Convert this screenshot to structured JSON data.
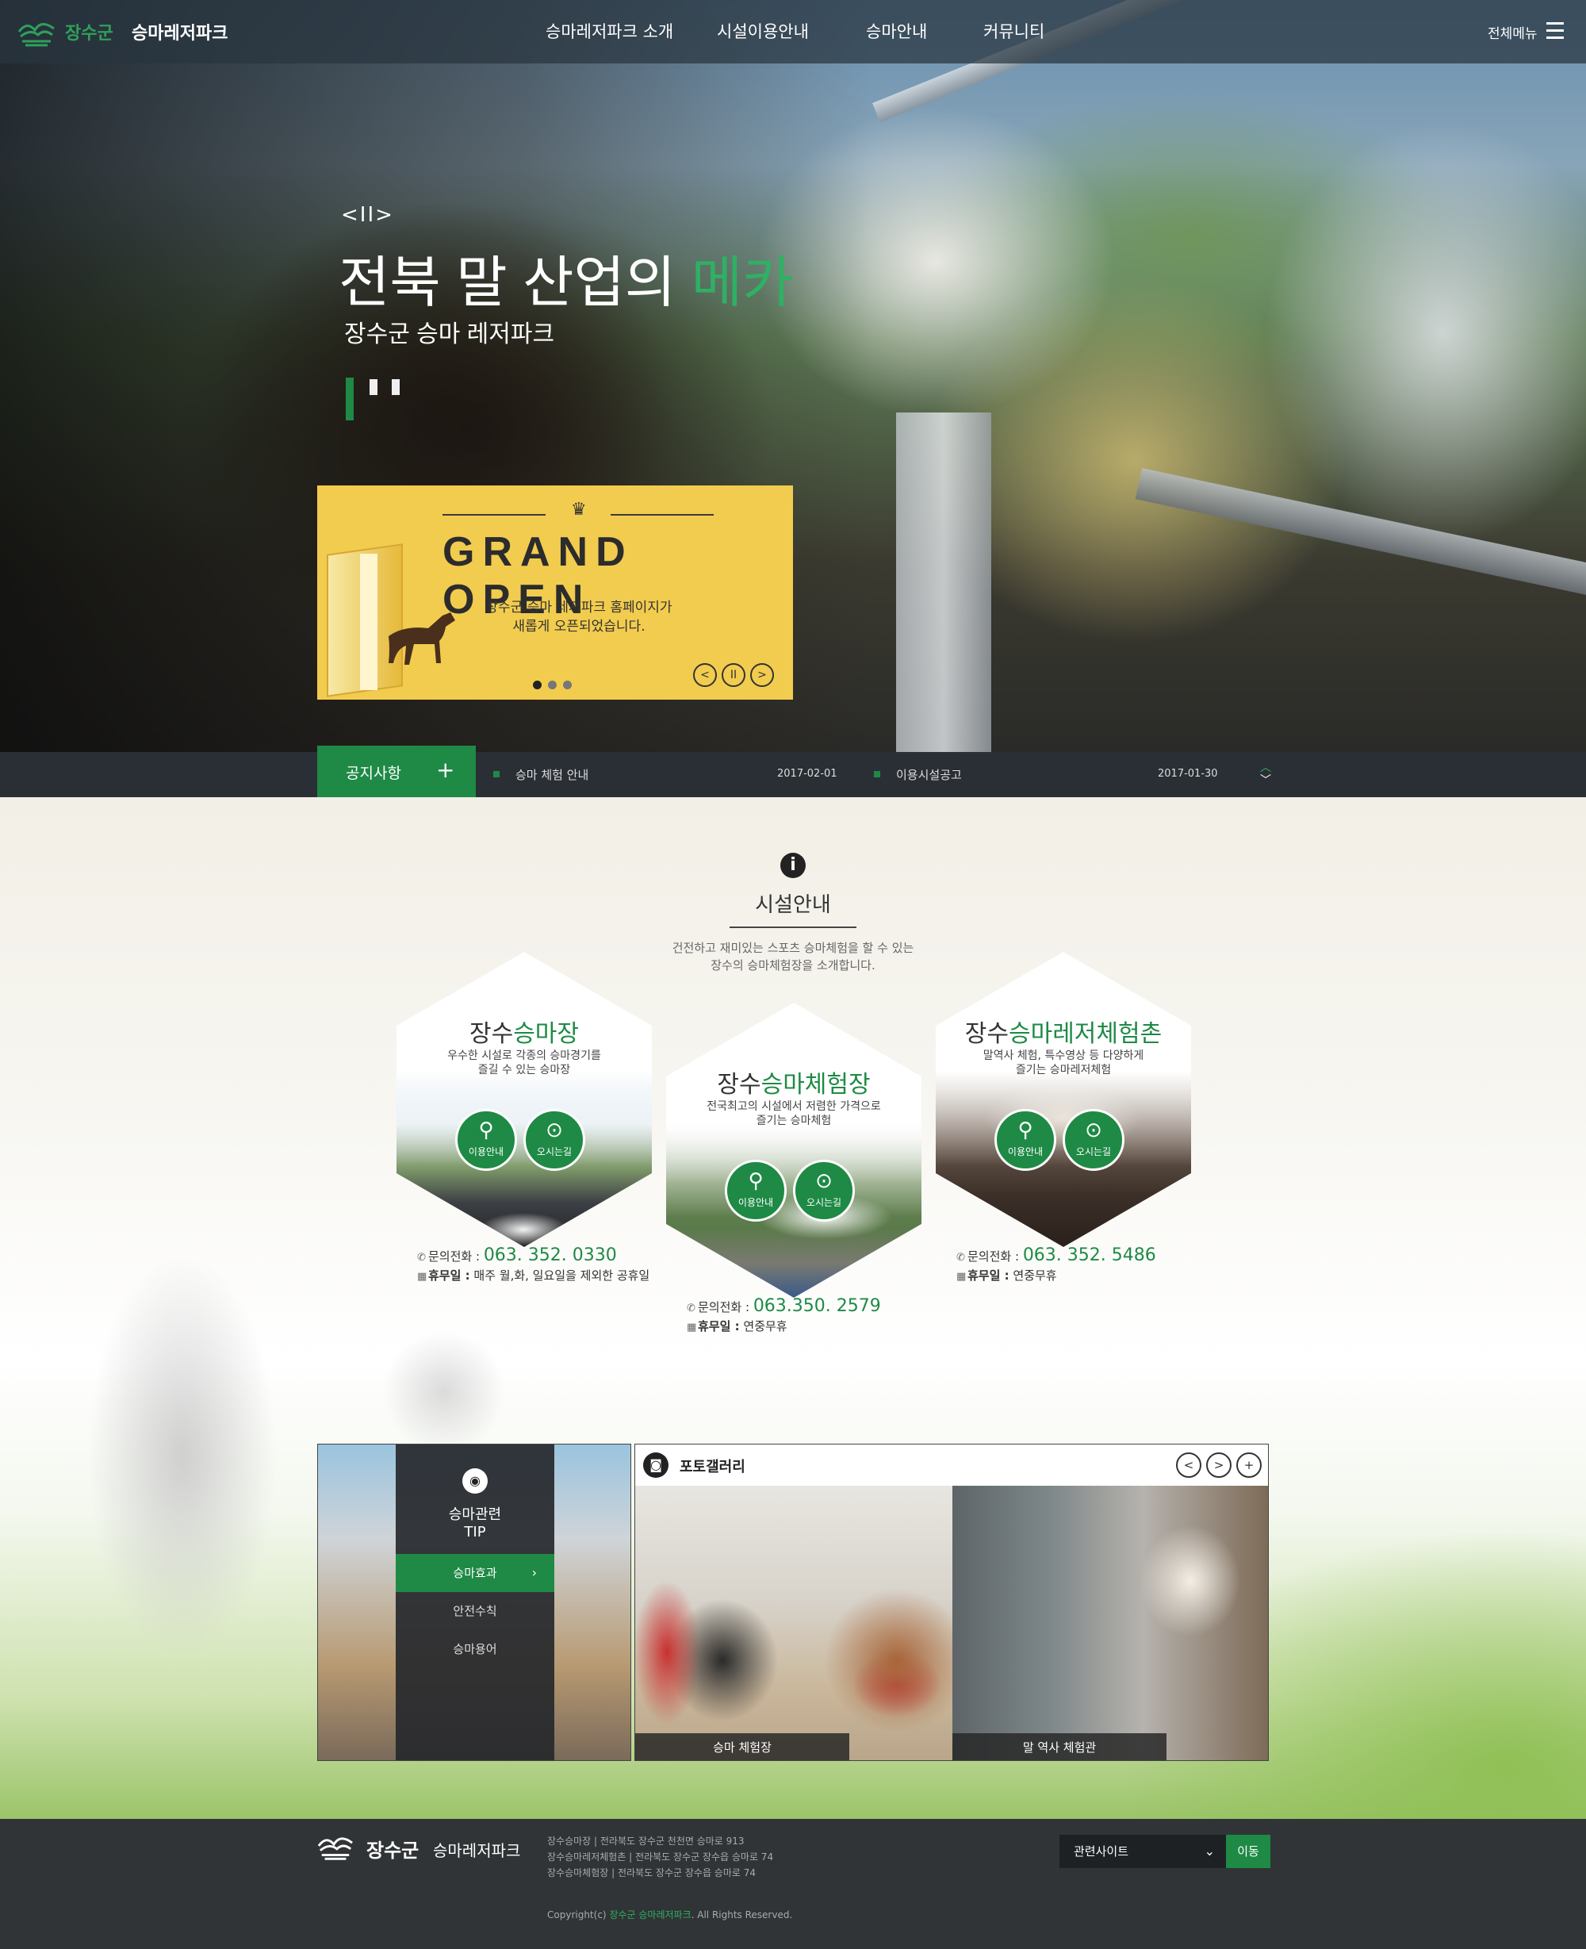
{
  "nav": {
    "brand": "장수군",
    "park": "승마레저파크",
    "items": [
      "승마레저파크 소개",
      "시설이용안내",
      "승마안내",
      "커뮤니티"
    ],
    "all_menu": "전체메뉴"
  },
  "hero": {
    "controls": "<II>",
    "title_main": "전북 말 산업의",
    "title_accent": "메카",
    "subtitle": "장수군 승마 레저파크"
  },
  "popup": {
    "title": "GRAND OPEN",
    "desc_line1": "장수군 승마 레저파크 홈페이지가",
    "desc_line2": "새롭게 오픈되었습니다.",
    "prev": "<",
    "pause": "II",
    "next": ">"
  },
  "notice": {
    "tab": "공지사항",
    "plus": "+",
    "items": [
      {
        "title": "승마 체험 안내",
        "date": "2017-02-01"
      },
      {
        "title": "이용시설공고",
        "date": "2017-01-30"
      }
    ]
  },
  "facilities": {
    "title": "시설안내",
    "desc_line1": "건전하고 재미있는 스포츠 승마체험을 할 수 있는",
    "desc_line2": "장수의 승마체험장을 소개합니다.",
    "btn_info": "이용안내",
    "btn_map": "오시는길",
    "phone_label": "문의전화 :",
    "holiday_label": "휴무일 :",
    "cards": [
      {
        "title_a": "장수",
        "title_b": "승마장",
        "desc1": "우수한 시설로 각종의 승마경기를",
        "desc2": "즐길 수 있는 승마장",
        "phone": "063. 352. 0330",
        "holiday": "매주 월,화, 일요일을 제외한 공휴일"
      },
      {
        "title_a": "장수",
        "title_b": "승마체험장",
        "desc1": "전국최고의 시설에서 저렴한 가격으로",
        "desc2": "즐기는 승마체험",
        "phone": "063.350. 2579",
        "holiday": "연중무휴"
      },
      {
        "title_a": "장수",
        "title_b": "승마레저체험촌",
        "desc1": "말역사 체험, 특수영상 등 다양하게",
        "desc2": "즐기는 승마레저체험",
        "phone": "063. 352. 5486",
        "holiday": "연중무휴"
      }
    ]
  },
  "tip": {
    "title_line1": "승마관련",
    "title_line2": "TIP",
    "items": [
      "승마효과",
      "안전수칙",
      "승마용어"
    ]
  },
  "gallery": {
    "title": "포토갤러리",
    "prev": "<",
    "next": ">",
    "more": "+",
    "photos": [
      "승마 체험장",
      "말 역사 체험관"
    ]
  },
  "footer": {
    "brand": "장수군",
    "park": "승마레저파크",
    "addr": [
      "장수승마장   |   전라북도 장수군 천천면 승마로 913",
      "장수승마레저체험촌   |   전라북도 장수군 장수읍 승마로 74",
      "장수승마체험장   |   전라북도 장수군 장수읍 승마로 74"
    ],
    "copy_pre": "Copyright(c)",
    "copy_name": "장수군 승마레저파크",
    "copy_post": ". All Rights Reserved.",
    "select": "관련사이트",
    "go": "이동"
  },
  "colors": {
    "accent": "#1e8a45",
    "accent_light": "#2fb063",
    "popup_bg": "#f2cc4e",
    "footer_bg": "#303436"
  }
}
